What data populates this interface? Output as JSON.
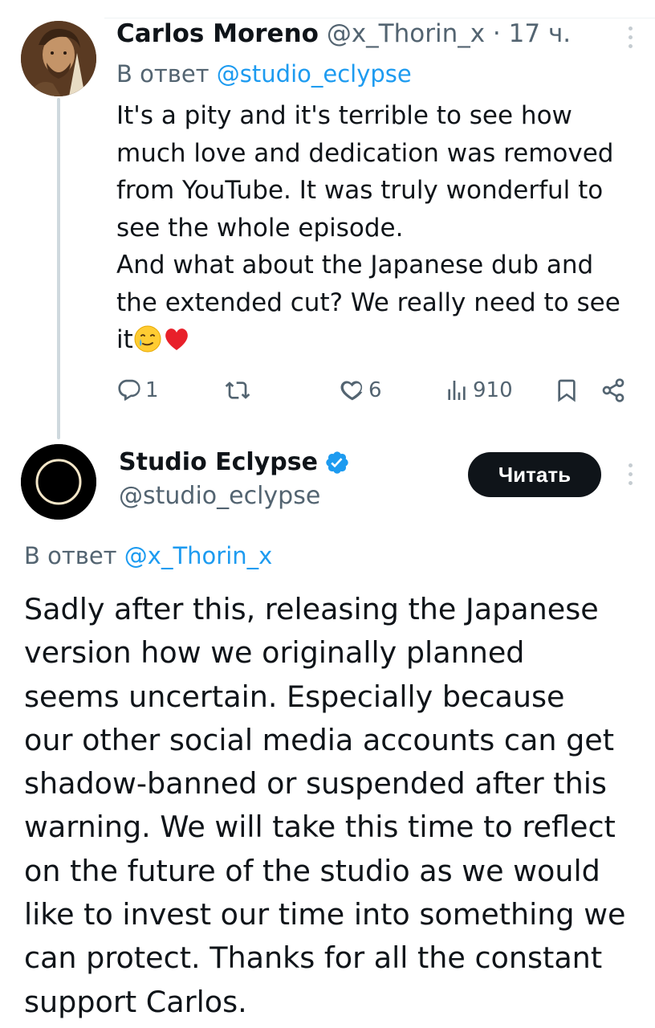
{
  "parent_tweet": {
    "author_name": "Carlos Moreno",
    "handle": "@x_Thorin_x",
    "separator": "·",
    "time": "17 ч.",
    "reply_prefix": "В ответ",
    "reply_to": "@studio_eclypse",
    "text_lines": [
      "It's a pity and it's terrible to see how",
      "much love and dedication was removed",
      "from YouTube. It was truly wonderful to",
      "see the whole episode.",
      "And what about the Japanese dub and",
      "the extended cut? We really need to see",
      "it"
    ],
    "emojis": [
      "smiling-face-with-tear-emoji",
      "red-heart-emoji"
    ],
    "actions": {
      "replies": "1",
      "reposts": "",
      "likes": "6",
      "views": "910"
    }
  },
  "main_tweet": {
    "author_name": "Studio Eclypse",
    "verified": true,
    "handle": "@studio_eclypse",
    "follow_label": "Читать",
    "reply_prefix": "В ответ",
    "reply_to": "@x_Thorin_x",
    "text_lines": [
      "Sadly after this, releasing the Japanese",
      "version how we originally planned",
      "seems uncertain. Especially because",
      "our other social media accounts can get",
      "shadow-banned or suspended after this",
      "warning. We will take this time to reflect",
      "on the future of the studio as we would",
      "like to invest our time into something we",
      "can protect. Thanks for all the constant",
      "support Carlos."
    ]
  },
  "colors": {
    "text_primary": "#0f1419",
    "text_secondary": "#536471",
    "link": "#1d9bf0",
    "thread_line": "#cfd9de",
    "button_bg": "#0f1419",
    "verified_badge": "#1d9bf0"
  },
  "icons": [
    "reply-icon",
    "repost-icon",
    "like-icon",
    "views-icon",
    "bookmark-icon",
    "share-icon",
    "more-icon",
    "verified-badge-icon"
  ]
}
